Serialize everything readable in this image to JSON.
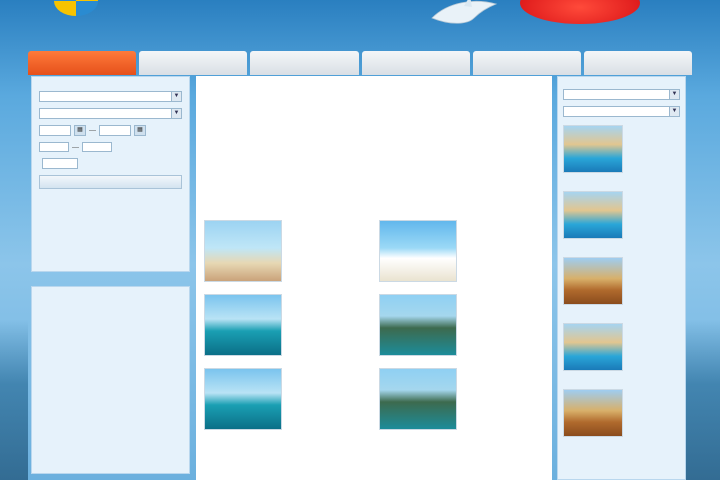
{
  "header": {
    "logo_text": ""
  },
  "promo": {
    "label": ""
  },
  "nav": {
    "tabs": [
      {
        "label": "",
        "active": true
      },
      {
        "label": ""
      },
      {
        "label": ""
      },
      {
        "label": ""
      },
      {
        "label": ""
      },
      {
        "label": ""
      }
    ]
  },
  "search": {
    "title": "",
    "field1_label": "",
    "field1_value": "",
    "field2_label": "",
    "field2_value": "",
    "dates_label": "",
    "date_from": "",
    "date_to": "",
    "duration_label": "",
    "duration_from": "",
    "duration_to": "",
    "persons_label": "",
    "persons_value": "",
    "persons_suffix": "",
    "button": ""
  },
  "news": {
    "title": "",
    "items": [
      {
        "date": "",
        "text": "",
        "more": ""
      },
      {
        "date": "",
        "text": "",
        "more": ""
      }
    ]
  },
  "main": {
    "title": "",
    "intro": "",
    "tours_title": "",
    "tours": [
      {
        "name": "",
        "desc": "",
        "price": "",
        "img": "hammock"
      },
      {
        "name": "",
        "desc": "",
        "price": "",
        "img": "beach"
      },
      {
        "name": "",
        "desc": "",
        "price": "",
        "img": "pier"
      },
      {
        "name": "",
        "desc": "",
        "price": "",
        "img": "cliff"
      },
      {
        "name": "",
        "desc": "",
        "price": "",
        "img": "pier"
      },
      {
        "name": "",
        "desc": "",
        "price": "",
        "img": "cliff"
      }
    ]
  },
  "hot": {
    "title": "",
    "field1_label": "",
    "field1_value": "",
    "field2_label": "",
    "field2_value": "",
    "items": [
      {
        "name": "",
        "desc": "",
        "img": "pool"
      },
      {
        "name": "",
        "desc": "",
        "img": "pool"
      },
      {
        "name": "",
        "desc": "",
        "img": "hotel"
      },
      {
        "name": "",
        "desc": "",
        "img": "pool"
      },
      {
        "name": "",
        "desc": "",
        "img": "hotel"
      }
    ]
  },
  "colors": {
    "accent": "#e5501b",
    "panel": "#e6f2fb",
    "link": "#1f5a92"
  }
}
